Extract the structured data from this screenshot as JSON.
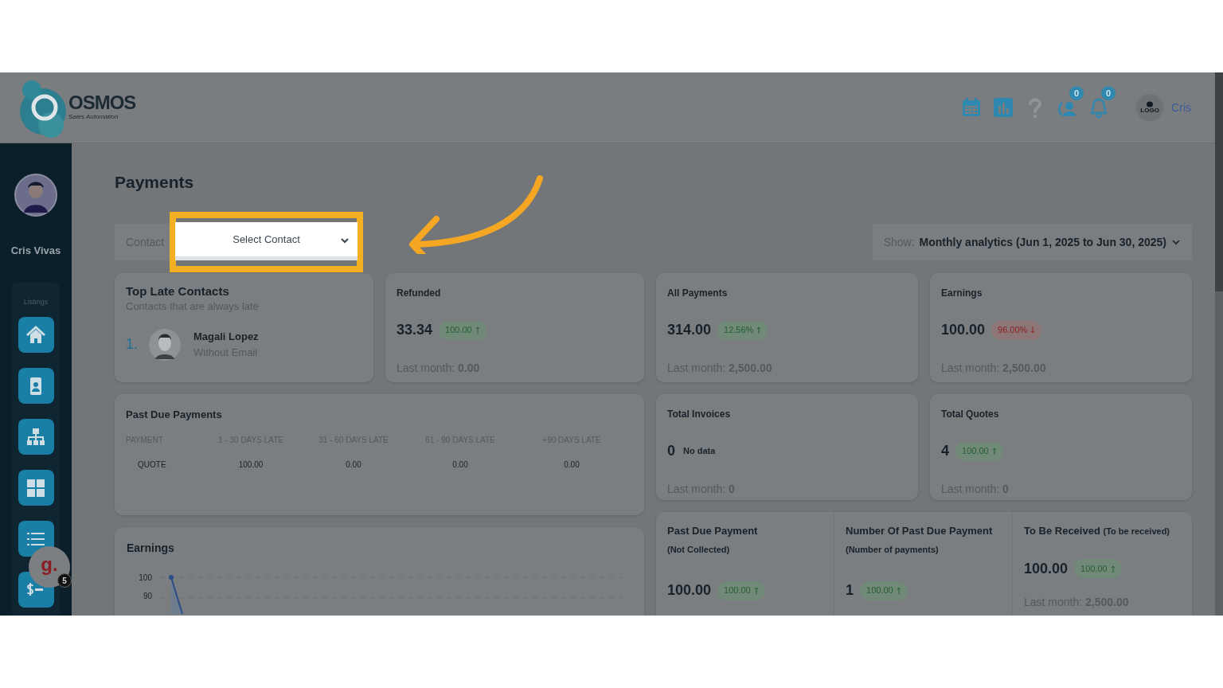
{
  "header": {
    "logo": {
      "name": "OSMOS",
      "tagline": "Sales Automation"
    },
    "tools": [
      {
        "kind": "calendar"
      },
      {
        "kind": "chart"
      },
      {
        "kind": "help"
      },
      {
        "kind": "contacts",
        "badge": "0"
      },
      {
        "kind": "bell",
        "badge": "0"
      }
    ],
    "user": {
      "avatar_text": "LOGO",
      "name": "Cris"
    }
  },
  "sidebar": {
    "user_name": "Cris Vivas",
    "section": "Listings",
    "nav": [
      {
        "kind": "home"
      },
      {
        "kind": "contact-card"
      },
      {
        "kind": "org-chart"
      },
      {
        "kind": "grid"
      },
      {
        "kind": "list"
      },
      {
        "kind": "dollar"
      }
    ]
  },
  "chat_bubble": {
    "text": "g.",
    "badge": "5"
  },
  "page_title": "Payments",
  "contact_filter": {
    "label": "Contact",
    "value": "Select Contact"
  },
  "period": {
    "label": "Show:",
    "value": "Monthly analytics (Jun 1, 2025 to Jun 30, 2025)"
  },
  "top_late_contacts": {
    "title": "Top Late Contacts",
    "subtitle": "Contacts that are always late",
    "contacts": [
      {
        "rank": "1.",
        "name": "Magali Lopez",
        "email": "Without Email"
      }
    ]
  },
  "stat_cards": [
    {
      "title": "Refunded",
      "value": "33.34",
      "trend": {
        "value": "100.00",
        "rising": true
      },
      "last_month_label": "Last month:",
      "last_month_value": "0.00"
    },
    {
      "title": "All Payments",
      "value": "314.00",
      "trend": {
        "value": "12.56%",
        "rising": true
      },
      "last_month_label": "Last month:",
      "last_month_value": "2,500.00"
    },
    {
      "title": "Earnings",
      "value": "100.00",
      "trend": {
        "value": "96.00%",
        "rising": false
      },
      "last_month_label": "Last month:",
      "last_month_value": "2,500.00"
    },
    {
      "title": "Total Invoices",
      "value": "0",
      "note": "No data",
      "last_month_label": "Last month:",
      "last_month_value": "0"
    },
    {
      "title": "Total Quotes",
      "value": "4",
      "trend": {
        "value": "100.00",
        "rising": true
      },
      "last_month_label": "Last month:",
      "last_month_value": "0"
    }
  ],
  "past_due": {
    "title": "Past Due Payments",
    "columns": [
      "PAYMENT",
      "1 - 30 DAYS LATE",
      "31 - 60 DAYS LATE",
      "61 - 90 DAYS LATE",
      "+90 DAYS LATE"
    ],
    "rows": [
      [
        "QUOTE",
        "100.00",
        "0.00",
        "0.00",
        "0.00"
      ]
    ]
  },
  "earnings_chart": {
    "title": "Earnings",
    "y_tick_labels": [
      "100",
      "90"
    ]
  },
  "past_due_summary": [
    {
      "title": "Past Due Payment",
      "subtitle": "(Not Collected)",
      "value": "100.00",
      "trend": {
        "value": "100.00",
        "rising": true
      }
    },
    {
      "title": "Number Of Past Due Payment",
      "subtitle": "(Number of payments)",
      "value": "1",
      "trend": {
        "value": "100.00",
        "rising": true
      }
    },
    {
      "title": "To Be Received",
      "subtitle": "(To be received)",
      "value": "100.00",
      "trend": {
        "value": "100.00",
        "rising": true
      },
      "last_month_label": "Last month:",
      "last_month_value": "2,500.00"
    }
  ]
}
